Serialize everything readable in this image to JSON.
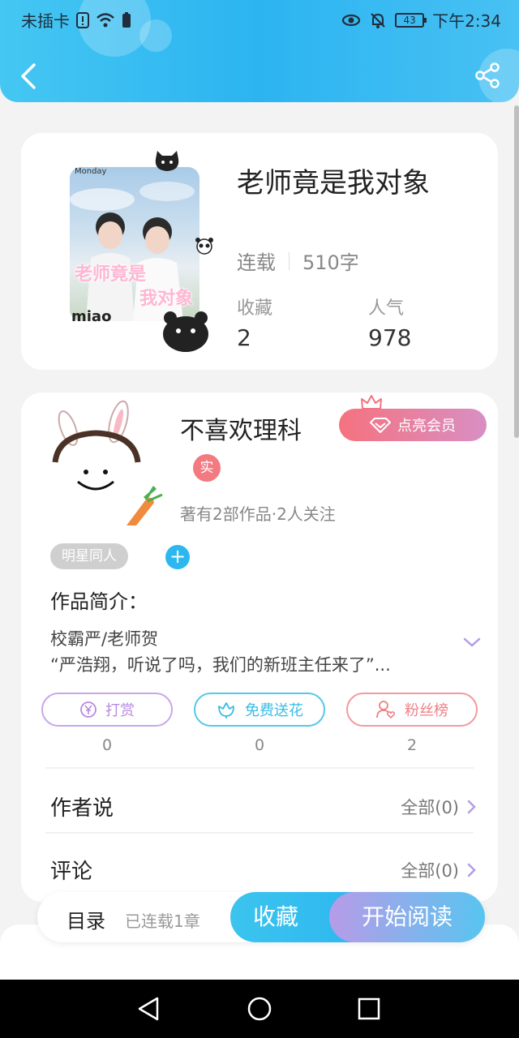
{
  "status_bar": {
    "carrier": "未插卡",
    "battery": "43",
    "time": "下午2:34"
  },
  "book": {
    "title": "老师竟是我对象",
    "status": "连载",
    "word_count": "510字",
    "favorites_label": "收藏",
    "favorites_value": "2",
    "popularity_label": "人气",
    "popularity_value": "978",
    "cover_text_line1": "老师竟是",
    "cover_text_line2": "我对象",
    "cover_brand": "miao",
    "cover_badge": "Monday"
  },
  "author": {
    "name": "不喜欢理科",
    "vip_label": "点亮会员",
    "real_badge": "实",
    "stats": "著有2部作品·2人关注",
    "tag": "明星同人",
    "tag_add": "+"
  },
  "intro": {
    "heading": "作品简介：",
    "line1": "校霸严/老师贺",
    "line2": "“严浩翔，听说了吗，我们的新班主任来了”..."
  },
  "actions": [
    {
      "label": "打赏",
      "count": "0",
      "color": "#c08be0"
    },
    {
      "label": "免费送花",
      "count": "0",
      "color": "#38c0e8"
    },
    {
      "label": "粉丝榜",
      "count": "2",
      "color": "#ef7f85"
    }
  ],
  "rows": {
    "author_says": {
      "title": "作者说",
      "link": "全部(0)"
    },
    "comments": {
      "title": "评论",
      "link": "全部(0)"
    }
  },
  "bottom_bar": {
    "toc": "目录",
    "chapters": "已连载1章",
    "collect": "收藏",
    "read": "开始阅读"
  },
  "colors": {
    "accent_blue": "#2cb8ef",
    "vip_pink": "#f5727f",
    "purple": "#b79be8"
  }
}
